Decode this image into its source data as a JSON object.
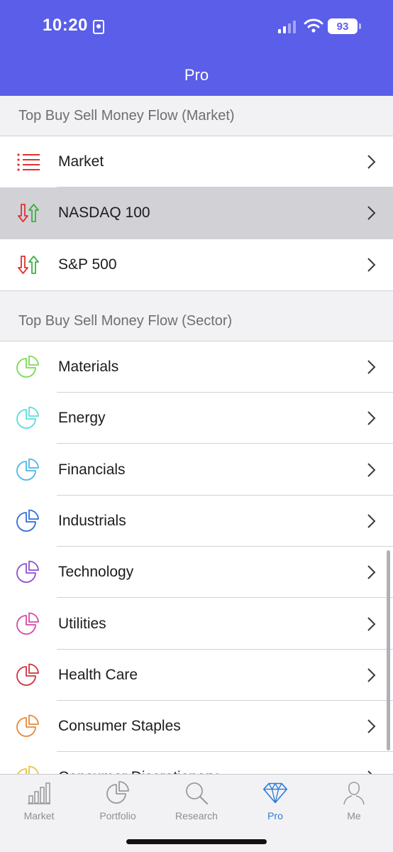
{
  "status_bar": {
    "time": "10:20",
    "battery": "93"
  },
  "header": {
    "title": "Pro"
  },
  "sections": [
    {
      "title": "Top Buy Sell Money Flow (Market)",
      "items": [
        {
          "label": "Market",
          "icon": "list-icon"
        },
        {
          "label": "NASDAQ 100",
          "icon": "arrows-updown-icon"
        },
        {
          "label": "S&P 500",
          "icon": "arrows-updown-icon"
        }
      ]
    },
    {
      "title": "Top Buy Sell Money Flow (Sector)",
      "items": [
        {
          "label": "Materials",
          "icon": "pie-chart-icon",
          "color": "#7ed957"
        },
        {
          "label": "Energy",
          "icon": "pie-chart-icon",
          "color": "#5fdcdc"
        },
        {
          "label": "Financials",
          "icon": "pie-chart-icon",
          "color": "#4ab8e8"
        },
        {
          "label": "Industrials",
          "icon": "pie-chart-icon",
          "color": "#2f6fd6"
        },
        {
          "label": "Technology",
          "icon": "pie-chart-icon",
          "color": "#8f4fd0"
        },
        {
          "label": "Utilities",
          "icon": "pie-chart-icon",
          "color": "#d64aa8"
        },
        {
          "label": "Health Care",
          "icon": "pie-chart-icon",
          "color": "#cf3340"
        },
        {
          "label": "Consumer Staples",
          "icon": "pie-chart-icon",
          "color": "#e8893a"
        },
        {
          "label": "Consumer Discretionary",
          "icon": "pie-chart-icon",
          "color": "#e8c43a"
        }
      ]
    }
  ],
  "tabbar": {
    "tabs": [
      {
        "label": "Market",
        "icon": "bar-chart-icon"
      },
      {
        "label": "Portfolio",
        "icon": "pie-chart-icon"
      },
      {
        "label": "Research",
        "icon": "magnifier-icon"
      },
      {
        "label": "Pro",
        "icon": "diamond-icon",
        "active": true
      },
      {
        "label": "Me",
        "icon": "person-icon"
      }
    ]
  },
  "colors": {
    "header_bg": "#5a5ee9",
    "accent": "#2d7bd8",
    "down": "#e03030",
    "up": "#3cb043"
  }
}
